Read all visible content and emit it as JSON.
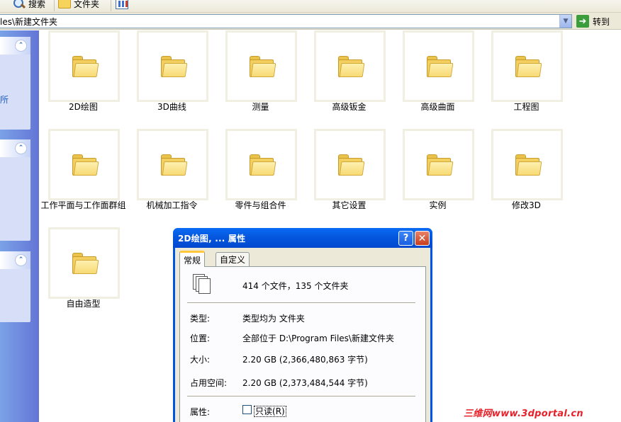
{
  "toolbar": {
    "search_label": "搜索",
    "folders_label": "文件夹"
  },
  "address": {
    "path": "les\\新建文件夹",
    "go_label": "转到"
  },
  "taskpane": {
    "partial_text": "所"
  },
  "folders": [
    "2D绘图",
    "3D曲线",
    "测量",
    "高级钣金",
    "高级曲面",
    "工程图",
    "工作平面与工作面群组",
    "机械加工指令",
    "零件与组合件",
    "其它设置",
    "实例",
    "修改3D",
    "自由造型"
  ],
  "dialog": {
    "title": "2D绘图, ... 属性",
    "help_glyph": "?",
    "close_glyph": "✕",
    "tabs": {
      "general": "常规",
      "custom": "自定义"
    },
    "summary": "414 个文件，135 个文件夹",
    "rows": {
      "type_label": "类型:",
      "type_value": "类型均为 文件夹",
      "location_label": "位置:",
      "location_value": "全部位于 D:\\Program Files\\新建文件夹",
      "size_label": "大小:",
      "size_value": "2.20 GB (2,366,480,863 字节)",
      "disk_label": "占用空间:",
      "disk_value": "2.20 GB (2,373,484,544 字节)",
      "attr_label": "属性:",
      "readonly_label": "只读",
      "readonly_key": "(R)"
    },
    "readonly_checked": false
  },
  "watermark": "三维网www.3dportal.cn",
  "colors": {
    "titlebar": "#0457de",
    "taskpane": "#6375d6",
    "folder": "#f2cf5e",
    "watermark": "#e8202a"
  }
}
